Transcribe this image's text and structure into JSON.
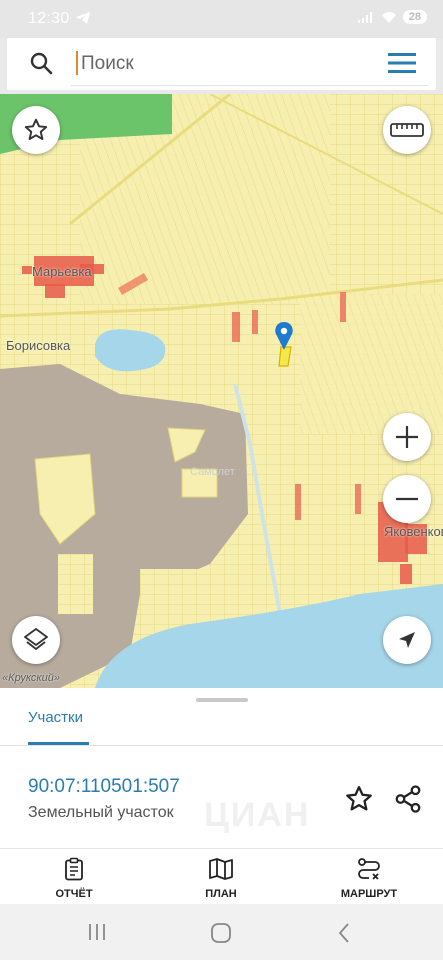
{
  "status_bar": {
    "time": "12:30",
    "battery": "28"
  },
  "search": {
    "placeholder": "Поиск"
  },
  "map": {
    "labels": {
      "village_top": "Марьевка",
      "village_left": "Борисовка",
      "village_right": "Яковенково",
      "watermark": "Самолет",
      "coast": "«Крукский»"
    }
  },
  "sheet": {
    "tab_label": "Участки",
    "parcel_number": "90:07:110501:507",
    "parcel_type": "Земельный участок",
    "watermark": "ЦИАН"
  },
  "bottom_nav": {
    "report": "ОТЧЁТ",
    "plan": "ПЛАН",
    "route": "МАРШРУТ"
  },
  "colors": {
    "accent": "#2a7db0",
    "parcel_fill": "#f7efb0",
    "land_dark": "#b6ab9c",
    "water": "#a6d6ea",
    "green": "#6cc46a",
    "settlement": "#e85a4a"
  }
}
